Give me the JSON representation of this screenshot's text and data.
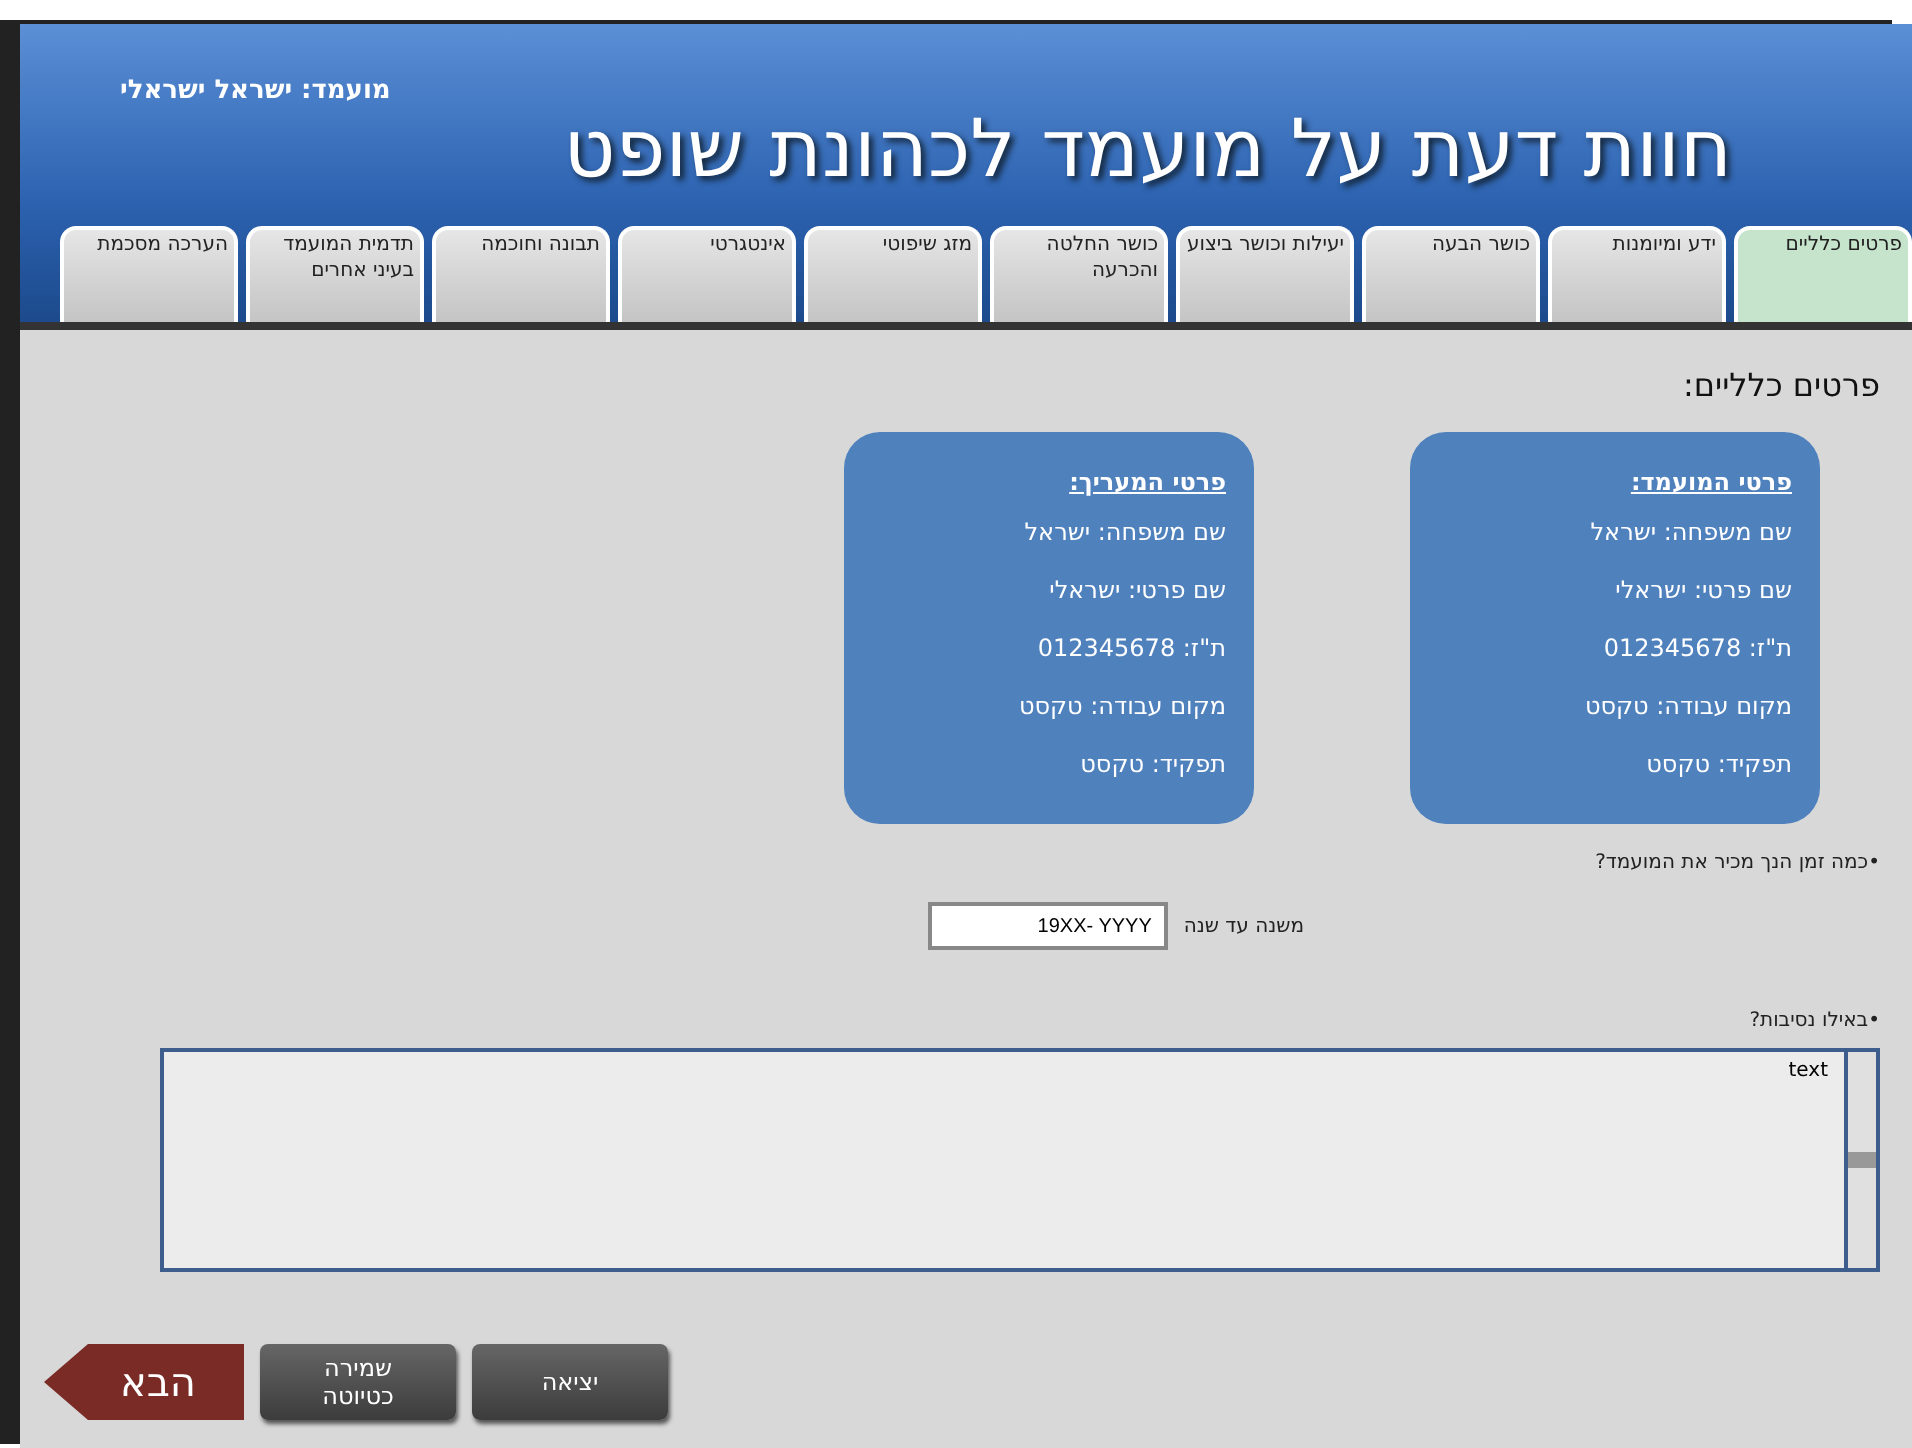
{
  "header": {
    "candidate": "מועמד: ישראל ישראלי",
    "title": "חוות דעת על מועמד לכהונת שופט"
  },
  "tabs": [
    {
      "label": "פרטים כלליים",
      "selected": true
    },
    {
      "label": "ידע ומיומנות",
      "selected": false
    },
    {
      "label": "כושר הבעה",
      "selected": false
    },
    {
      "label": "יעילות וכושר ביצוע",
      "selected": false
    },
    {
      "label": "כושר החלטה והכרעה",
      "selected": false
    },
    {
      "label": "מזג שיפוטי",
      "selected": false
    },
    {
      "label": "אינטגרטי",
      "selected": false
    },
    {
      "label": "תבונה וחוכמה",
      "selected": false
    },
    {
      "label": "תדמית המועמד בעיני אחרים",
      "selected": false
    },
    {
      "label": "הערכה מסכמת",
      "selected": false
    }
  ],
  "section_title": "פרטים כלליים:",
  "cards": [
    {
      "heading": "פרטי המועמד:",
      "lines": [
        "שם משפחה: ישראל",
        "שם פרטי: ישראלי",
        "ת\"ז: 012345678",
        "מקום עבודה: טקסט",
        "תפקיד: טקסט"
      ]
    },
    {
      "heading": "פרטי המעריך:",
      "lines": [
        "שם משפחה: ישראל",
        "שם פרטי: ישראלי",
        "ת\"ז: 012345678",
        "מקום עבודה: טקסט",
        "תפקיד: טקסט"
      ]
    }
  ],
  "question_1": {
    "text": "•כמה זמן הנך מכיר את המועמד?",
    "field_label": "משנה עד שנה",
    "field_value": "19XX- YYYY"
  },
  "question_2": {
    "text": "•באילו נסיבות?",
    "answer": "text"
  },
  "buttons": [
    {
      "kind": "plain",
      "label": "יציאה"
    },
    {
      "kind": "plain",
      "label": "שמירה כטיוטה"
    },
    {
      "kind": "next",
      "label": "הבא"
    }
  ]
}
